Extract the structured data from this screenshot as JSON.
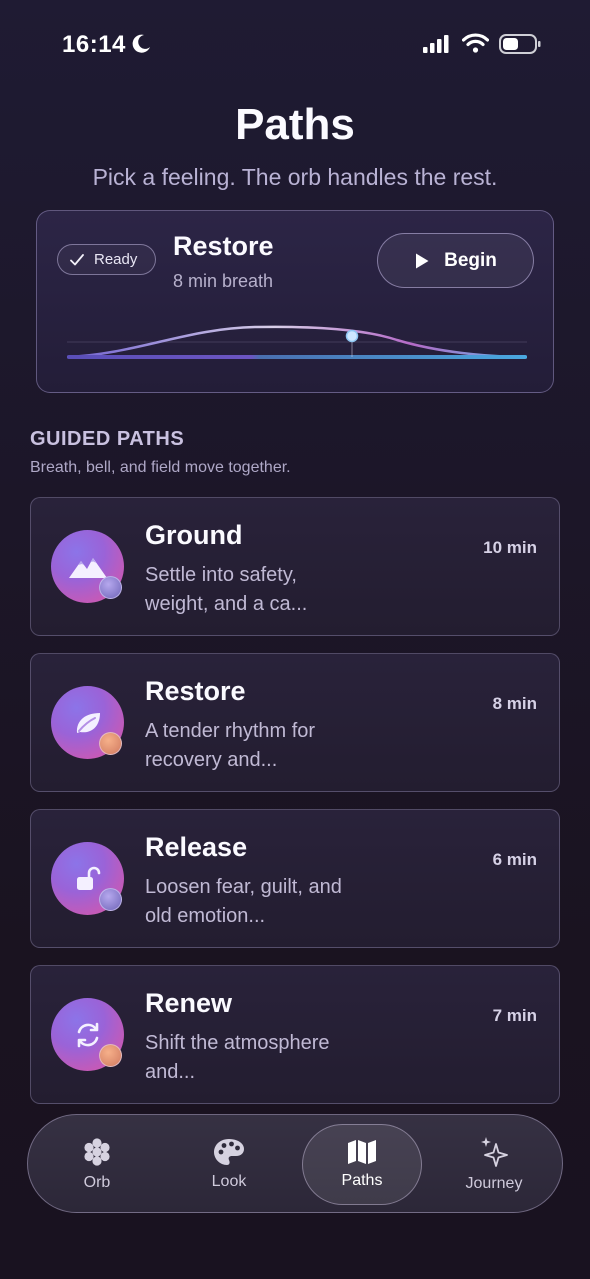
{
  "status_bar": {
    "time": "16:14"
  },
  "header": {
    "title": "Paths",
    "subtitle": "Pick a feeling. The orb handles the rest."
  },
  "hero": {
    "status_label": "Ready",
    "title": "Restore",
    "subtitle": "8 min breath",
    "begin_label": "Begin",
    "progress": 0.62
  },
  "section": {
    "title": "GUIDED PATHS",
    "subtitle": "Breath, bell, and field move together."
  },
  "paths": [
    {
      "title": "Ground",
      "description": "Settle into safety, weight, and a ca...",
      "duration": "10 min",
      "icon": "mountains-icon",
      "accent": "#7c6fcf"
    },
    {
      "title": "Restore",
      "description": "A tender rhythm for recovery and...",
      "duration": "8 min",
      "icon": "leaf-icon",
      "accent": "#e08a70"
    },
    {
      "title": "Release",
      "description": "Loosen fear, guilt, and old emotion...",
      "duration": "6 min",
      "icon": "unlock-icon",
      "accent": "#7c6fcf"
    },
    {
      "title": "Renew",
      "description": "Shift the atmosphere and...",
      "duration": "7 min",
      "icon": "refresh-icon",
      "accent": "#e08a70"
    }
  ],
  "tabs": [
    {
      "label": "Orb",
      "icon": "orb-cluster-icon",
      "active": false
    },
    {
      "label": "Look",
      "icon": "palette-icon",
      "active": false
    },
    {
      "label": "Paths",
      "icon": "map-icon",
      "active": true
    },
    {
      "label": "Journey",
      "icon": "sparkles-icon",
      "active": false
    }
  ]
}
